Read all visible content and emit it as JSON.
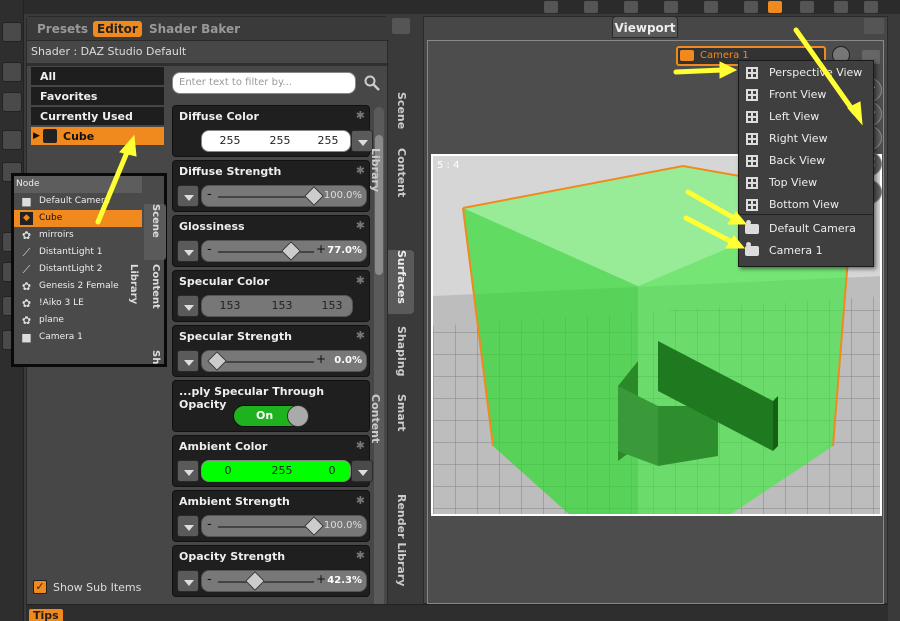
{
  "colors": {
    "accent": "#f08a1e",
    "arrow": "#ffff33",
    "green_box": "#22dd22",
    "panel_bg": "#474747"
  },
  "left_panel": {
    "tabs": [
      "Presets",
      "Editor",
      "Shader Baker"
    ],
    "active_tab": "Editor",
    "shader_label": "Shader : DAZ Studio Default",
    "categories": [
      "All",
      "Favorites",
      "Currently Used",
      "Cube"
    ],
    "selected_category": "Cube",
    "filter_placeholder": "Enter text to filter by...",
    "show_sub_items_label": "Show Sub Items",
    "show_sub_items_checked": true
  },
  "scene_inset": {
    "header": "Node",
    "nodes": [
      {
        "label": "Default Camera",
        "icon": "camera-icon"
      },
      {
        "label": "Cube",
        "icon": "cube-icon"
      },
      {
        "label": "mirroirs",
        "icon": "figure-icon"
      },
      {
        "label": "DistantLight 1",
        "icon": "light-icon"
      },
      {
        "label": "DistantLight 2",
        "icon": "light-icon"
      },
      {
        "label": "Genesis 2 Female",
        "icon": "figure-icon"
      },
      {
        "label": "!Aiko 3 LE",
        "icon": "figure-icon"
      },
      {
        "label": "plane",
        "icon": "figure-icon"
      },
      {
        "label": "Camera 1",
        "icon": "camera-icon"
      }
    ],
    "selected_node": "Cube",
    "side_tabs": [
      "Scene",
      "Content Library",
      "Sh"
    ]
  },
  "properties": [
    {
      "name": "Diffuse Color",
      "kind": "color",
      "values": [
        "255",
        "255",
        "255"
      ]
    },
    {
      "name": "Diffuse Strength",
      "kind": "slider",
      "value_text": "100.0%",
      "fraction": 1.0
    },
    {
      "name": "Glossiness",
      "kind": "slider",
      "value_text": "77.0%",
      "fraction": 0.77
    },
    {
      "name": "Specular Color",
      "kind": "color",
      "values": [
        "153",
        "153",
        "153"
      ]
    },
    {
      "name": "Specular Strength",
      "kind": "slider",
      "value_text": "0.0%",
      "fraction": 0.0
    },
    {
      "name": "...ply Specular Through Opacity",
      "kind": "toggle",
      "value_text": "On"
    },
    {
      "name": "Ambient Color",
      "kind": "color",
      "values": [
        "0",
        "255",
        "0"
      ]
    },
    {
      "name": "Ambient Strength",
      "kind": "slider",
      "value_text": "100.0%",
      "fraction": 1.0
    },
    {
      "name": "Opacity Strength",
      "kind": "slider",
      "value_text": "42.3%",
      "fraction": 0.423
    }
  ],
  "vertical_tabs": [
    "Scene",
    "Content Library",
    "Surfaces",
    "Shaping",
    "Smart Content",
    "Render Library"
  ],
  "active_vertical_tab": "Surfaces",
  "tips_label": "Tips",
  "viewport": {
    "tab_label": "Viewport",
    "camera_select": "Camera 1",
    "aspect_label": "5 : 4",
    "menu_views": [
      "Perspective View",
      "Front View",
      "Left View",
      "Right View",
      "Back View",
      "Top View",
      "Bottom View"
    ],
    "menu_cameras": [
      "Default Camera",
      "Camera 1"
    ]
  }
}
